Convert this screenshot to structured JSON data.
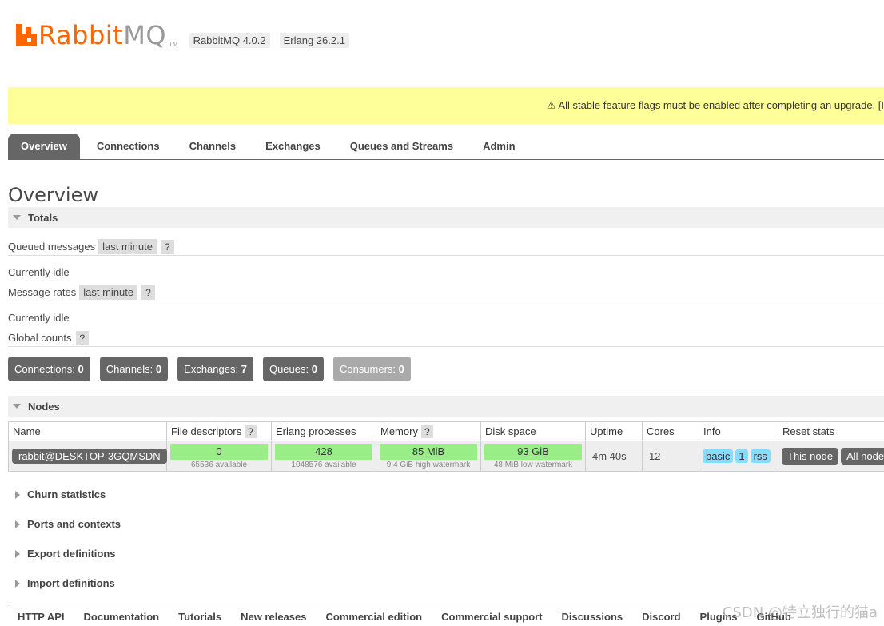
{
  "header": {
    "logo_rabbit": "Rabbit",
    "logo_mq": "MQ",
    "logo_tm": "TM",
    "rabbitmq_version": "RabbitMQ 4.0.2",
    "erlang_version": "Erlang 26.2.1"
  },
  "banner": {
    "text": "⚠ All stable feature flags must be enabled after completing an upgrade. [I"
  },
  "tabs": [
    {
      "label": "Overview",
      "active": true
    },
    {
      "label": "Connections"
    },
    {
      "label": "Channels"
    },
    {
      "label": "Exchanges"
    },
    {
      "label": "Queues and Streams"
    },
    {
      "label": "Admin"
    }
  ],
  "page_title": "Overview",
  "totals": {
    "heading": "Totals",
    "queued_label": "Queued messages",
    "queued_range": "last minute",
    "help": "?",
    "idle1": "Currently idle",
    "rates_label": "Message rates",
    "rates_range": "last minute",
    "idle2": "Currently idle",
    "global_label": "Global counts"
  },
  "counts": [
    {
      "label": "Connections:",
      "value": "0"
    },
    {
      "label": "Channels:",
      "value": "0"
    },
    {
      "label": "Exchanges:",
      "value": "7"
    },
    {
      "label": "Queues:",
      "value": "0"
    },
    {
      "label": "Consumers:",
      "value": "0"
    }
  ],
  "nodes": {
    "heading": "Nodes",
    "columns": [
      "Name",
      "File descriptors",
      "Erlang processes",
      "Memory",
      "Disk space",
      "Uptime",
      "Cores",
      "Info",
      "Reset stats"
    ],
    "row": {
      "name": "rabbit@DESKTOP-3GQMSDN",
      "fd": "0",
      "fd_sub": "65536 available",
      "proc": "428",
      "proc_sub": "1048576 available",
      "mem": "85 MiB",
      "mem_sub": "9.4 GiB high watermark",
      "disk": "93 GiB",
      "disk_sub": "48 MiB low watermark",
      "uptime": "4m 40s",
      "cores": "12",
      "info": [
        "basic",
        "1",
        "rss"
      ],
      "reset": [
        "This node",
        "All nodes"
      ]
    }
  },
  "collapsed": [
    "Churn statistics",
    "Ports and contexts",
    "Export definitions",
    "Import definitions"
  ],
  "footer": [
    "HTTP API",
    "Documentation",
    "Tutorials",
    "New releases",
    "Commercial edition",
    "Commercial support",
    "Discussions",
    "Discord",
    "Plugins",
    "GitHub"
  ],
  "watermark": "CSDN @特立独行的猫a",
  "colors": {
    "brand": "#ff6600",
    "banner": "#ffff99",
    "ok_bar": "#99ee88",
    "info_pill": "#88ddff"
  }
}
